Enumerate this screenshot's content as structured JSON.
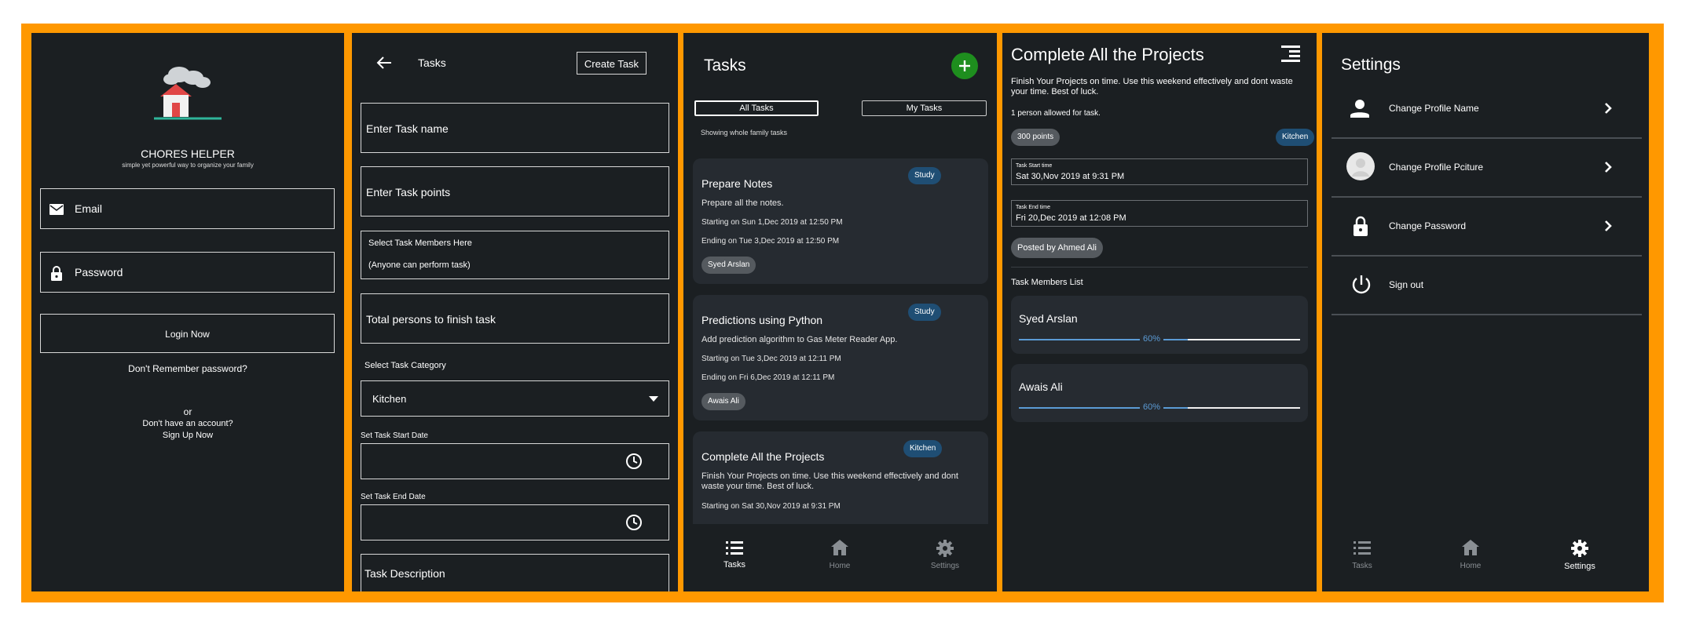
{
  "colors": {
    "frame": "#ff9800",
    "screen_bg": "#1b1f22",
    "card_bg": "#262b31",
    "progress": "#5b9bd5",
    "tag_bg": "#1f4e74",
    "fab": "#1e8e1e",
    "grey_chip": "#555a5f"
  },
  "login": {
    "app_title": "CHORES HELPER",
    "tagline": "simple yet powerful way to organize your family",
    "email_label": "Email",
    "password_label": "Password",
    "login_button": "Login Now",
    "forgot": "Don't Remember password?",
    "or": "or",
    "no_account": "Don't have an account?",
    "signup": "Sign Up Now"
  },
  "create_task": {
    "title": "Tasks",
    "create_button": "Create Task",
    "task_name_placeholder": "Enter Task name",
    "task_points_placeholder": "Enter Task points",
    "members_label": "Select Task Members Here",
    "members_value": "(Anyone can perform task)",
    "total_persons_placeholder": "Total persons to finish task",
    "category_label": "Select Task Category",
    "category_value": "Kitchen",
    "start_date_label": "Set Task Start Date",
    "end_date_label": "Set Task End Date",
    "description_placeholder": "Task Description"
  },
  "task_list": {
    "title": "Tasks",
    "tab_all": "All Tasks",
    "tab_mine": "My Tasks",
    "showing": "Showing whole family tasks",
    "cards": [
      {
        "title": "Prepare Notes",
        "tag": "Study",
        "desc": "Prepare all the notes.",
        "start": "Starting on Sun 1,Dec 2019  at  12:50 PM",
        "end": "Ending on Tue 3,Dec 2019  at  12:50 PM",
        "chip": "Syed Arslan"
      },
      {
        "title": "Predictions using Python",
        "tag": "Study",
        "desc": "Add prediction algorithm to Gas Meter Reader App.",
        "start": "Starting on Tue 3,Dec 2019  at  12:11 PM",
        "end": "Ending on Fri 6,Dec 2019  at  12:11 PM",
        "chip": "Awais Ali"
      },
      {
        "title": "Complete All the Projects",
        "tag": "Kitchen",
        "desc": "Finish Your Projects on time. Use this weekend effectively and dont waste your time. Best of luck.",
        "start": "Starting on Sat 30,Nov 2019  at  9:31 PM",
        "end": "",
        "chip": ""
      }
    ],
    "nav": {
      "tasks": "Tasks",
      "home": "Home",
      "settings": "Settings"
    }
  },
  "task_detail": {
    "title": "Complete All the Projects",
    "desc": "Finish Your Projects on time. Use this weekend effectively and dont waste your time. Best of luck.",
    "allowed": "1 person allowed for task.",
    "points": "300 points",
    "category": "Kitchen",
    "start_label": "Task Start time",
    "start_value": "Sat 30,Nov 2019  at  9:31 PM",
    "end_label": "Task End time",
    "end_value": "Fri 20,Dec 2019  at  12:08 PM",
    "posted_by": "Posted by Ahmed Ali",
    "members_header": "Task Members List",
    "members": [
      {
        "name": "Syed Arslan",
        "progress_label": "60%",
        "progress": 0.6
      },
      {
        "name": "Awais Ali",
        "progress_label": "60%",
        "progress": 0.6
      }
    ]
  },
  "settings": {
    "title": "Settings",
    "items": [
      {
        "label": "Change Profile Name",
        "icon": "person-icon"
      },
      {
        "label": "Change Profile Pciture",
        "icon": "avatar-icon"
      },
      {
        "label": "Change Password",
        "icon": "lock-icon"
      },
      {
        "label": "Sign out",
        "icon": "power-icon"
      }
    ],
    "nav": {
      "tasks": "Tasks",
      "home": "Home",
      "settings": "Settings"
    }
  }
}
